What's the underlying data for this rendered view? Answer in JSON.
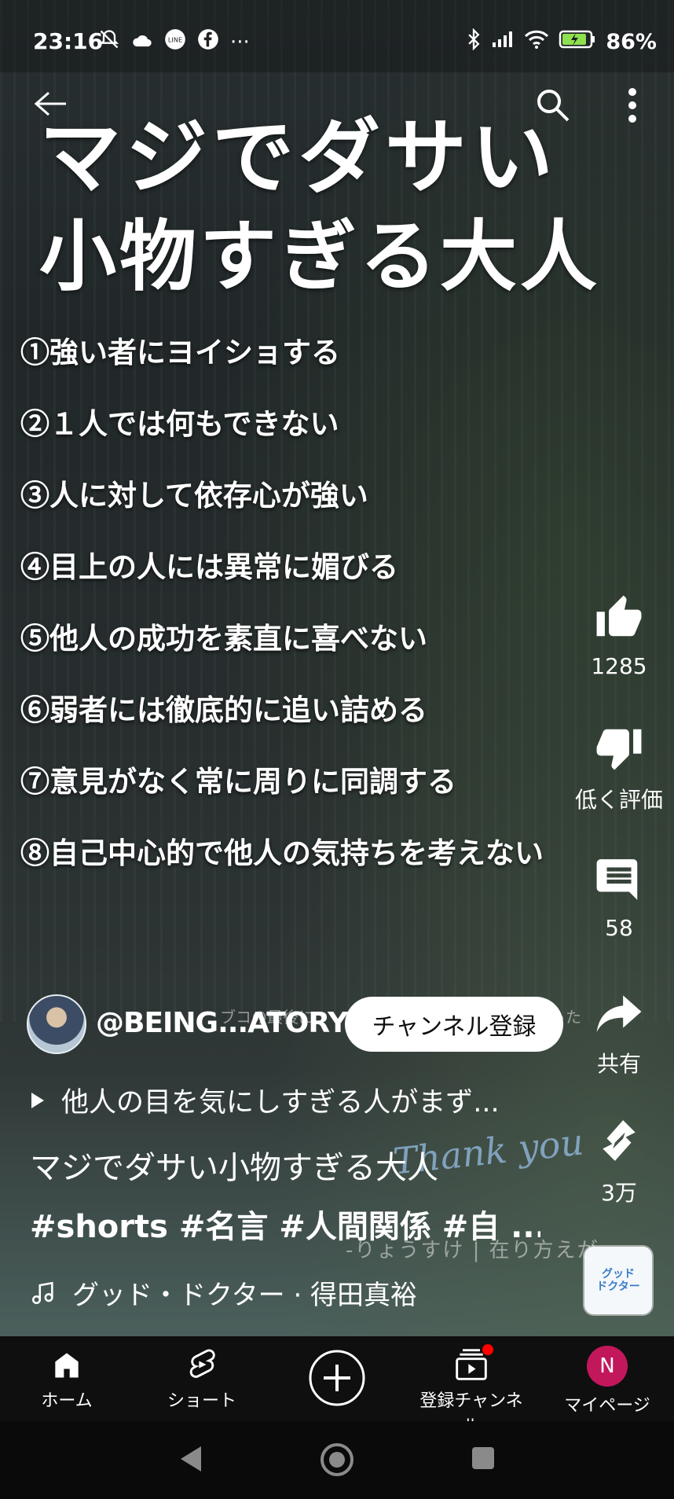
{
  "status_bar": {
    "time": "23:16",
    "battery": "86%",
    "left_icons": [
      "bell-off-icon",
      "cloud-icon",
      "line-icon",
      "facebook-icon",
      "more-dots-icon"
    ],
    "right_icons": [
      "bluetooth-icon",
      "signal-icon",
      "wifi-icon",
      "battery-icon"
    ]
  },
  "video_overlay": {
    "title_line1": "マジでダサい",
    "title_line2": "小物すぎる大人",
    "points": [
      "①強い者にヨイショする",
      "②１人では何もできない",
      "③人に対して依存心が強い",
      "④目上の人には異常に媚びる",
      "⑤他人の成功を素直に喜べない",
      "⑥弱者には徹底的に追い詰める",
      "⑦意見がなく常に周りに同調する",
      "⑧自己中心的で他人の気持ちを考えない"
    ],
    "watermark_top": "ブコの最後に",
    "watermark_top2": "った",
    "watermark_thanks": "Thank you",
    "watermark_author": "-りょうすけ | 在り方えが"
  },
  "actions": {
    "like_count": "1285",
    "dislike_label": "低く評価",
    "comment_count": "58",
    "share_label": "共有",
    "remix_count": "3万"
  },
  "channel": {
    "handle": "@BEING...ATORY",
    "subscribe_label": "チャンネル登録"
  },
  "related_video": "他人の目を気にしすぎる人がまず...",
  "video": {
    "title": "マジでダサい小物すぎる大人",
    "tags": "#shorts #名言 #人間関係 #自 ..."
  },
  "music": {
    "track": "グッド・ドクター · 得田真裕",
    "album_text_1": "グッド",
    "album_text_2": "ドクター"
  },
  "bottom_nav": {
    "home": "ホーム",
    "shorts": "ショート",
    "subscriptions": "登録チャンネル",
    "mypage": "マイページ",
    "avatar_letter": "N"
  },
  "colors": {
    "accent_red": "#ff0000",
    "avatar_pink": "#c2185b",
    "nav_bg": "#0f0f0f"
  }
}
